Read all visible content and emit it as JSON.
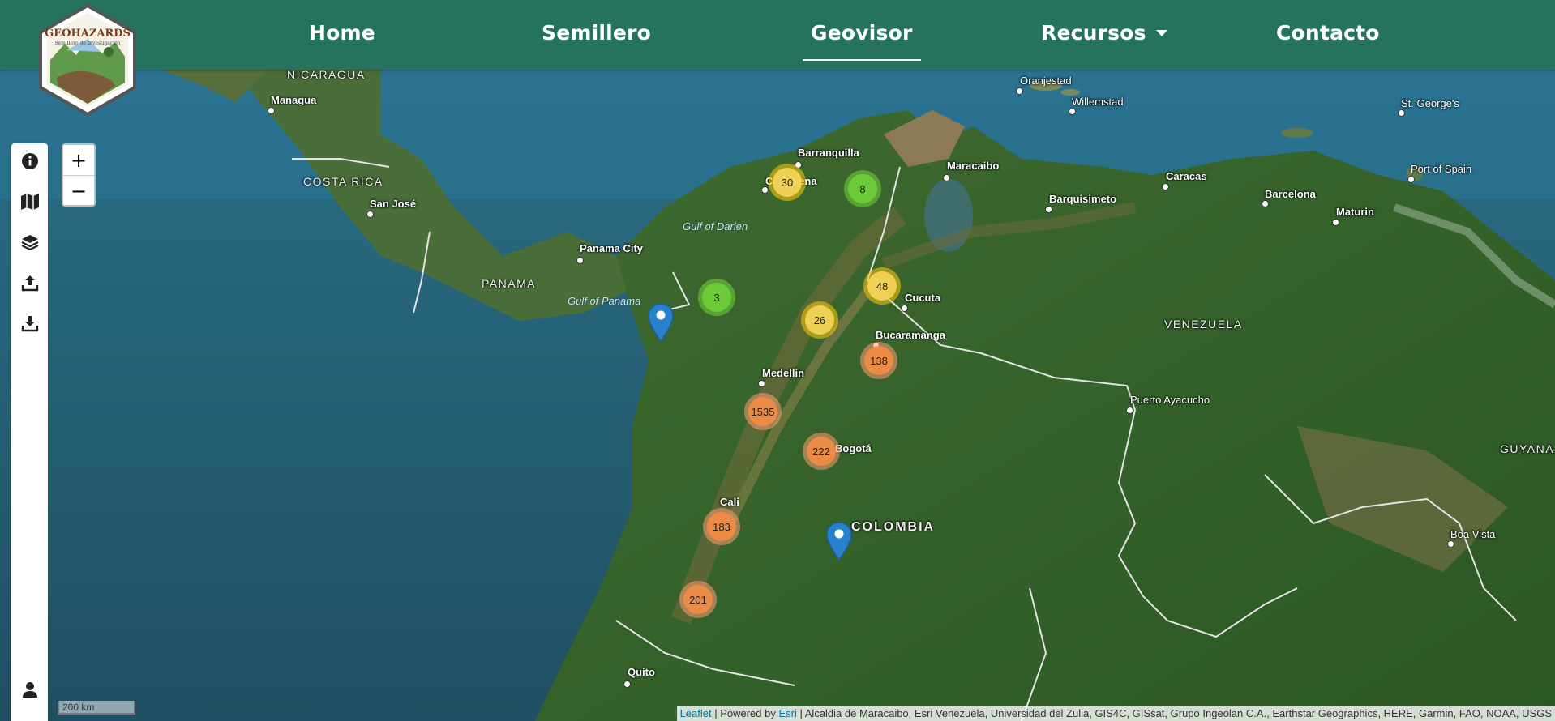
{
  "nav": {
    "logo_text": "GEOHAZARDS",
    "logo_subtitle": "Semillero de Investigación",
    "items": [
      {
        "label": "Home"
      },
      {
        "label": "Semillero"
      },
      {
        "label": "Geovisor"
      },
      {
        "label": "Recursos"
      },
      {
        "label": "Contacto"
      }
    ],
    "active": "Geovisor"
  },
  "map": {
    "countries": [
      "NICARAGUA",
      "COSTA RICA",
      "PANAMA",
      "VENEZUELA",
      "COLOMBIA",
      "GUYANA"
    ],
    "cities": [
      "Managua",
      "San José",
      "Panama City",
      "Barranquilla",
      "Cartagena",
      "Maracaibo",
      "Cucuta",
      "Bucaramanga",
      "Medellin",
      "Bogotá",
      "Cali",
      "Quito",
      "Caracas",
      "Barquisimeto",
      "Barcelona",
      "Maturin",
      "Puerto Ayacucho",
      "Boa Vista",
      "Oranjestad",
      "Willemstad",
      "St. George's",
      "Port of Spain"
    ],
    "water": [
      "Gulf of Darien",
      "Gulf of Panama"
    ],
    "clusters": [
      {
        "count": "30",
        "level": "medium"
      },
      {
        "count": "8",
        "level": "small"
      },
      {
        "count": "3",
        "level": "small"
      },
      {
        "count": "48",
        "level": "medium"
      },
      {
        "count": "26",
        "level": "medium"
      },
      {
        "count": "138",
        "level": "large"
      },
      {
        "count": "1535",
        "level": "large"
      },
      {
        "count": "222",
        "level": "large"
      },
      {
        "count": "183",
        "level": "large"
      },
      {
        "count": "201",
        "level": "large"
      }
    ],
    "scale": "200 km"
  },
  "attribution": {
    "leaflet": "Leaflet",
    "powered": " | Powered by ",
    "esri": "Esri",
    "rest": " | Alcaldia de Maracaibo, Esri Venezuela, Universidad del Zulia, GIS4C, GISsat, Grupo Ingeolan C.A., Earthstar Geographics, HERE, Garmin, FAO, NOAA, USGS"
  },
  "colors": {
    "navbar": "#25735e",
    "cluster_small": "#6ecc39",
    "cluster_medium": "#f0c20c",
    "cluster_large": "#ee8b46",
    "marker": "#2a81cb"
  },
  "sidebar_icons": [
    "info-icon",
    "map-icon",
    "layers-icon",
    "upload-icon",
    "download-icon",
    "user-icon"
  ]
}
